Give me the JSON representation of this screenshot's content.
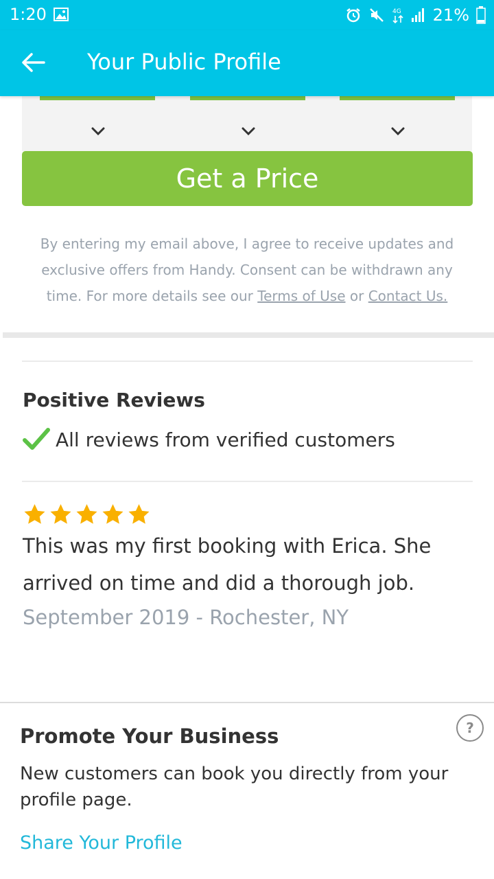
{
  "status_bar": {
    "time": "1:20",
    "battery_percent": "21%",
    "icons": [
      "gallery-icon",
      "alarm-icon",
      "mute-icon",
      "data-icon",
      "signal-icon",
      "battery-icon"
    ]
  },
  "app_bar": {
    "title": "Your Public Profile",
    "back_icon": "arrow-left-icon"
  },
  "price_button": {
    "label": "Get a Price"
  },
  "consent": {
    "text_before": "By entering my email above, I agree to receive updates and exclusive offers from Handy. Consent can be withdrawn any time. For more details see our",
    "terms_link": "Terms of Use",
    "or": "or",
    "contact_link": "Contact Us."
  },
  "reviews": {
    "title": "Positive Reviews",
    "verified_text": "All reviews from verified customers",
    "items": [
      {
        "rating": 5,
        "text": "This was my first booking with Erica. She arrived on time and did a thorough job.",
        "meta": "September 2019 - Rochester, NY"
      }
    ]
  },
  "promo": {
    "title": "Promote Your Business",
    "text": "New customers can book you directly from your profile page.",
    "share_link": "Share Your Profile"
  },
  "colors": {
    "primary": "#00c5e6",
    "green": "#86c440",
    "star": "#f9b000",
    "link": "#22b8d9",
    "muted_text": "#9aa3ad"
  }
}
